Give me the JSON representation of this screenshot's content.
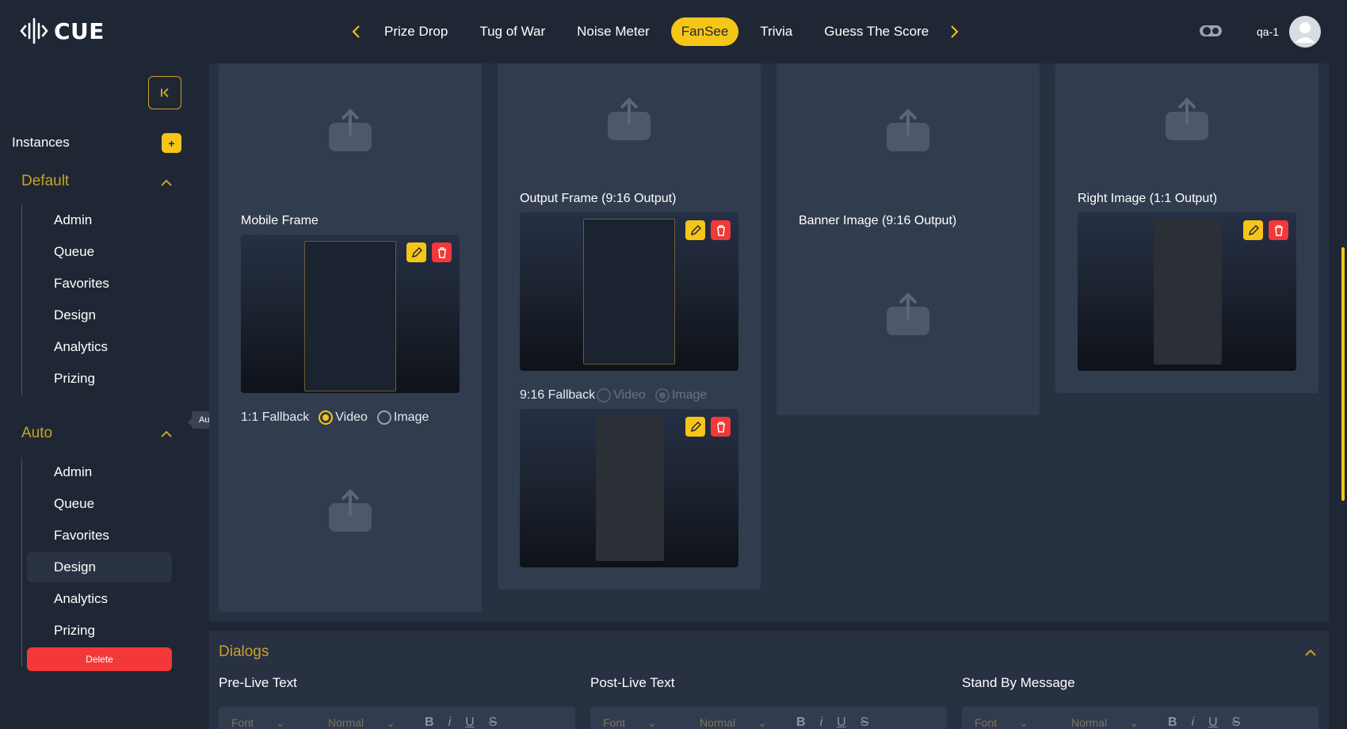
{
  "app": {
    "logo_text": "CUE"
  },
  "nav": {
    "tabs": [
      "Prize Drop",
      "Tug of War",
      "Noise Meter",
      "FanSee",
      "Trivia",
      "Guess The Score"
    ],
    "active": "FanSee"
  },
  "user": {
    "name": "qa-1"
  },
  "sidebar": {
    "instances_label": "Instances",
    "add_symbol": "+",
    "groups": [
      {
        "title": "Default",
        "items": [
          "Admin",
          "Queue",
          "Favorites",
          "Design",
          "Analytics",
          "Prizing"
        ]
      },
      {
        "title": "Auto",
        "items": [
          "Admin",
          "Queue",
          "Favorites",
          "Design",
          "Analytics",
          "Prizing"
        ],
        "active_item": "Design"
      }
    ],
    "delete_label": "Delete",
    "tooltip": "Auto"
  },
  "main": {
    "mobile_frame_label": "Mobile Frame",
    "fallback_1x1_label": "1:1 Fallback",
    "fallback_1x1_options": [
      "Video",
      "Image"
    ],
    "fallback_1x1_selected": "Video",
    "output_frame_label": "Output Frame (9:16 Output)",
    "fallback_916_label": "9:16 Fallback",
    "fallback_916_options": [
      "Video",
      "Image"
    ],
    "fallback_916_selected": "Image",
    "banner_image_label": "Banner Image (9:16 Output)",
    "right_image_label": "Right Image (1:1 Output)"
  },
  "dialogs": {
    "title": "Dialogs",
    "fields": [
      "Pre-Live Text",
      "Post-Live Text",
      "Stand By Message"
    ],
    "font_placeholder": "Font",
    "size_placeholder": "Normal",
    "format_buttons": [
      "B",
      "i",
      "U",
      "S"
    ]
  },
  "colors": {
    "accent": "#f5c518",
    "danger": "#f23838",
    "background": "#1f2734",
    "panel": "#283142"
  }
}
